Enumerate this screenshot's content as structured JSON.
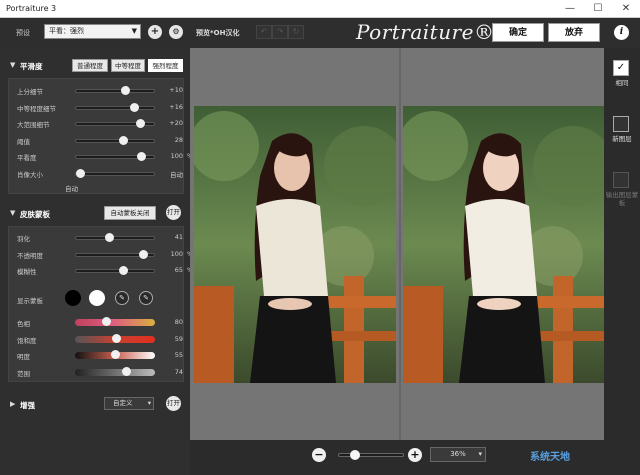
{
  "window": {
    "title": "Portraiture 3",
    "controls": [
      "—",
      "☐",
      "✕"
    ]
  },
  "toolbar": {
    "preset_label": "预设",
    "preset_value": "平看：强烈",
    "preview_label": "预览*OH汉化",
    "logo": "Portraiture® 3",
    "ok_label": "确定",
    "cancel_label": "放弃",
    "info_label": "i"
  },
  "smoothing": {
    "title": "平滑度",
    "chips": [
      "普通程度",
      "中等程度",
      "强烈程度"
    ],
    "active_chip": 2,
    "sliders": [
      {
        "label": "上分细节",
        "value": "+10",
        "level": 0.62
      },
      {
        "label": "中等程度细节",
        "value": "+16",
        "level": 0.75
      },
      {
        "label": "大范围细节",
        "value": "+20",
        "level": 0.83
      },
      {
        "label": "阈值",
        "value": "28",
        "level": 0.6
      },
      {
        "label": "平看度",
        "value": "100",
        "unit": "%",
        "level": 0.85
      },
      {
        "label": "肖像大小",
        "value": "自动",
        "level": 0.0
      }
    ],
    "auto_label": "自动"
  },
  "skin_mask": {
    "title": "皮肤蒙板",
    "auto_mask_label": "自动蒙板关闭",
    "open_label": "打开",
    "sliders": [
      {
        "label": "羽化",
        "value": "41",
        "level": 0.4
      },
      {
        "label": "不透明度",
        "value": "100",
        "unit": "%",
        "level": 0.87
      },
      {
        "label": "模糊性",
        "value": "65",
        "unit": "%",
        "level": 0.6
      }
    ],
    "show_mask_label": "显示蒙板",
    "color_sliders": [
      {
        "label": "色相",
        "value": "80",
        "level": 0.38
      },
      {
        "label": "饱和度",
        "value": "59",
        "level": 0.52
      },
      {
        "label": "明度",
        "value": "55",
        "level": 0.5
      },
      {
        "label": "范围",
        "value": "74",
        "level": 0.65
      }
    ]
  },
  "enhance": {
    "title": "增强",
    "custom_label": "自定义",
    "open_label": "打开"
  },
  "right_panel": {
    "same_layer_label": "相同",
    "new_layer_label": "新图层",
    "output_mask_label": "输出图层蒙板"
  },
  "bottom": {
    "zoom_value": "36%",
    "zoom_level": 0.2,
    "watermark": "系统天地"
  },
  "colors": {
    "accent_white": "#ffffff",
    "panel_bg": "#2f2f2f",
    "preview_bg": "#757575"
  }
}
